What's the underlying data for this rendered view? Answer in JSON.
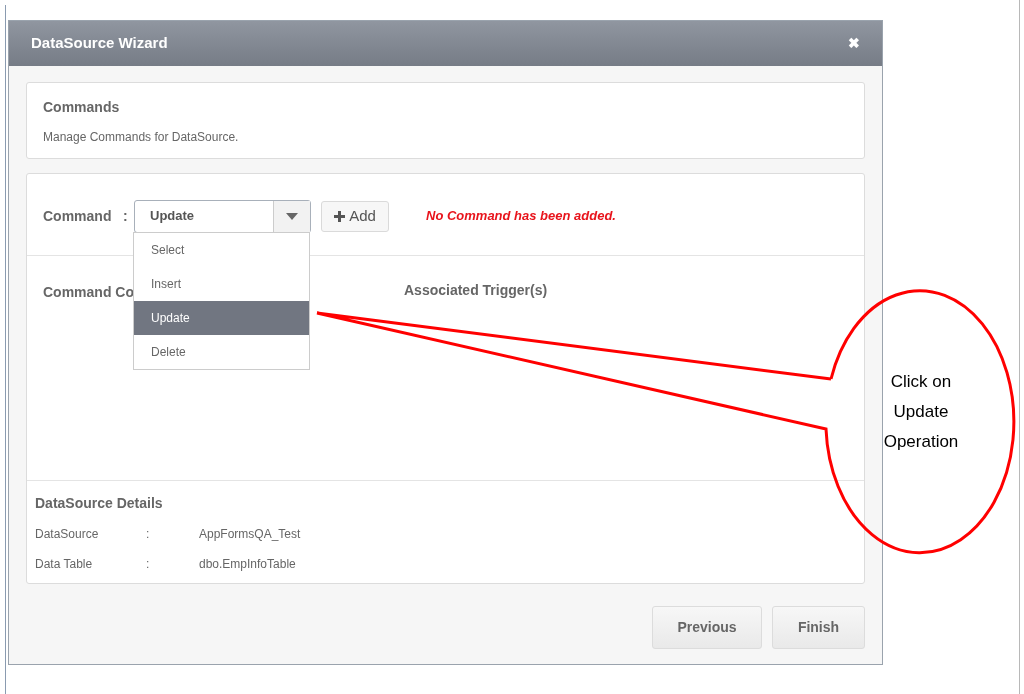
{
  "window": {
    "title": "DataSource Wizard",
    "close": "✖"
  },
  "header_card": {
    "title": "Commands",
    "description": "Manage Commands for DataSource."
  },
  "command_row": {
    "label": "Command",
    "separator": ":",
    "value": "Update",
    "add_button": "Add",
    "message": "No Command has been added."
  },
  "dropdown": {
    "options": [
      {
        "label": "Select",
        "selected": false
      },
      {
        "label": "Insert",
        "selected": false
      },
      {
        "label": "Update",
        "selected": true
      },
      {
        "label": "Delete",
        "selected": false
      }
    ]
  },
  "columns": [
    "Command Co",
    "Associated Trigger(s)"
  ],
  "details": {
    "title": "DataSource Details",
    "rows": [
      {
        "label": "DataSource",
        "separator": ":",
        "value": "AppFormsQA_Test"
      },
      {
        "label": "Data Table",
        "separator": ":",
        "value": "dbo.EmpInfoTable"
      }
    ]
  },
  "buttons": [
    "Previous",
    "Finish"
  ],
  "callout": {
    "text": "Click on Update Operation"
  }
}
